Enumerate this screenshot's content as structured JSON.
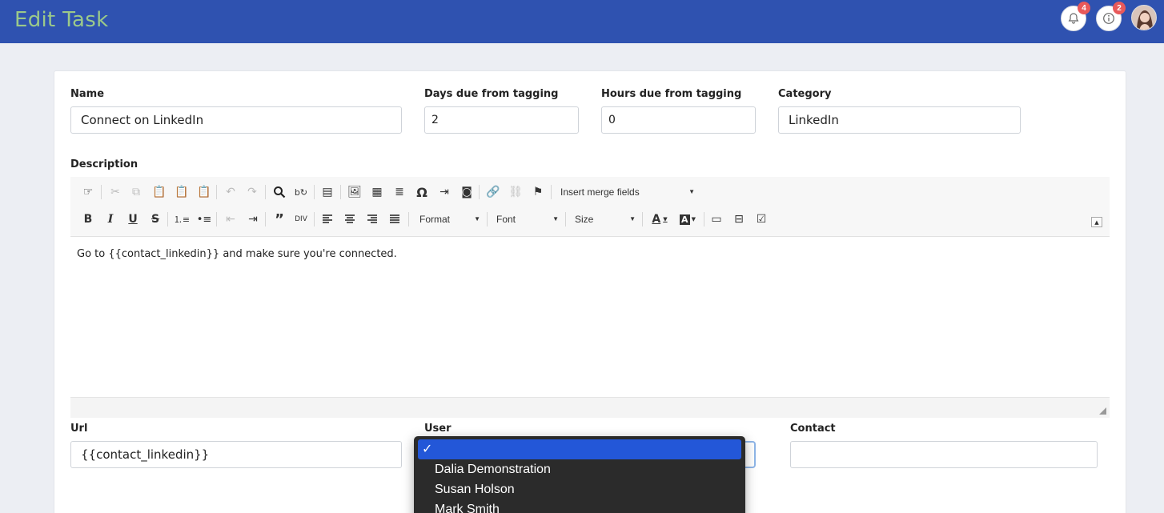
{
  "header": {
    "title": "Edit Task",
    "notifications_count": "4",
    "info_count": "2",
    "accent_color": "#2f52b0",
    "title_color": "#9bc98a",
    "badge_color": "#e8595a"
  },
  "form": {
    "name": {
      "label": "Name",
      "value": "Connect on LinkedIn"
    },
    "days_due": {
      "label": "Days due from tagging",
      "value": "2"
    },
    "hours_due": {
      "label": "Hours due from tagging",
      "value": "0"
    },
    "category": {
      "label": "Category",
      "value": "LinkedIn"
    },
    "description": {
      "label": "Description",
      "content": "Go to {{contact_linkedin}} and make sure you're connected."
    },
    "url": {
      "label": "Url",
      "value": "{{contact_linkedin}}"
    },
    "user": {
      "label": "User"
    },
    "contact": {
      "label": "Contact",
      "value": ""
    }
  },
  "editor_toolbar": {
    "merge_fields_label": "Insert merge fields",
    "format_label": "Format",
    "font_label": "Font",
    "size_label": "Size",
    "icons": [
      "paste-from-word-icon",
      "cut-icon",
      "copy-icon",
      "paste-icon",
      "paste-text-icon",
      "paste-word-icon",
      "undo-icon",
      "redo-icon",
      "find-icon",
      "replace-icon",
      "select-all-icon",
      "image-icon",
      "table-icon",
      "horizontal-line-icon",
      "special-char-icon",
      "indent-block-icon",
      "flash-icon",
      "link-icon",
      "unlink-icon",
      "anchor-icon",
      "bold-icon",
      "italic-icon",
      "underline-icon",
      "strike-icon",
      "numbered-list-icon",
      "bulleted-list-icon",
      "outdent-icon",
      "indent-icon",
      "blockquote-icon",
      "div-icon",
      "align-left-icon",
      "align-center-icon",
      "align-right-icon",
      "justify-icon",
      "text-color-icon",
      "bg-color-icon",
      "textfield-icon",
      "select-field-icon",
      "checkbox-icon"
    ]
  },
  "user_dropdown": {
    "selected_mark": "✓",
    "options": [
      "",
      "Dalia Demonstration",
      "Susan Holson",
      "Mark Smith"
    ],
    "highlight_color": "#2357d8"
  }
}
